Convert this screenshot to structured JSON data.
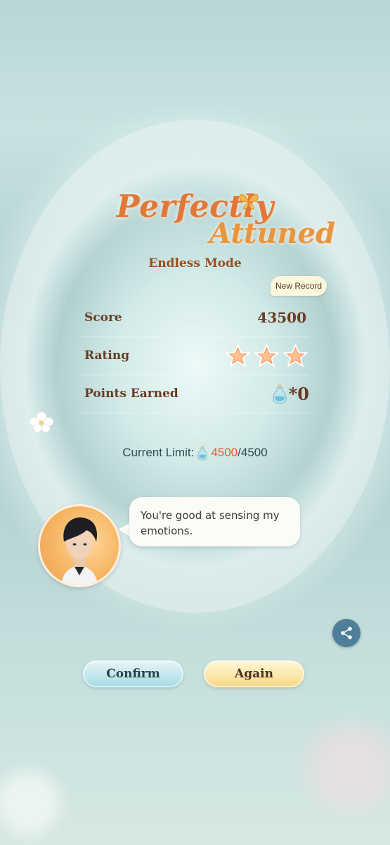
{
  "result": {
    "title_line1": "Perfectly",
    "title_line2": "Attuned",
    "mode": "Endless Mode",
    "badge": "New Record"
  },
  "stats": {
    "score_label": "Score",
    "score_value": "43500",
    "rating_label": "Rating",
    "rating_stars": 3,
    "rating_max": 3,
    "points_label": "Points Earned",
    "points_value": "*0"
  },
  "limit": {
    "label": "Current Limit:",
    "current": "4500",
    "separator": "/",
    "max": "4500"
  },
  "dialogue": {
    "text": "You're good at sensing my emotions."
  },
  "buttons": {
    "confirm": "Confirm",
    "again": "Again"
  },
  "icons": {
    "share": "share-icon",
    "butterfly": "butterfly-icon",
    "star": "star-icon",
    "bottle": "bottle-icon"
  },
  "colors": {
    "title": "#e0783a",
    "accent_orange": "#e6572a",
    "text_brown": "#6a3c22",
    "share_bg": "#4f7f98"
  }
}
